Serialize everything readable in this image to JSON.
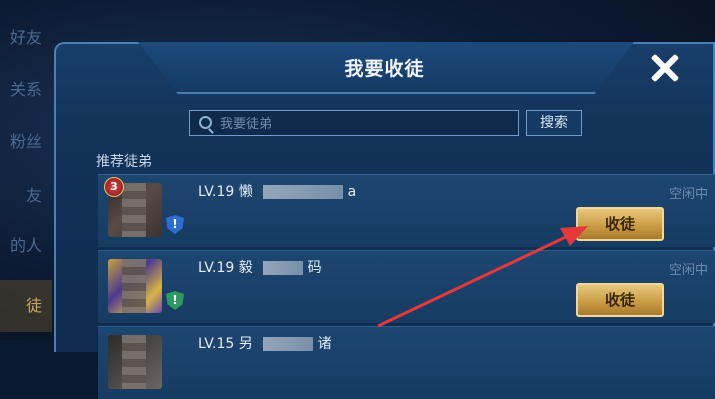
{
  "left_nav": [
    {
      "label": "好友",
      "active": false
    },
    {
      "label": "关系",
      "active": false
    },
    {
      "label": "粉丝",
      "active": false
    },
    {
      "label": "友",
      "active": false
    },
    {
      "label": "的人",
      "active": false
    },
    {
      "label": "徒",
      "active": true
    }
  ],
  "dialog": {
    "title": "我要收徒",
    "close_icon": "close-icon"
  },
  "search": {
    "placeholder": "我要徒弟",
    "button_label": "搜索",
    "icon": "search-icon"
  },
  "section": {
    "label": "推荐徒弟"
  },
  "recommended": [
    {
      "level": "LV.19",
      "name": "懒",
      "name_suffix": "a",
      "status": "空闲中",
      "button": "收徒",
      "rank_badge": "3",
      "shield": "!"
    },
    {
      "level": "LV.19",
      "name": "毅",
      "name_suffix": "码",
      "status": "空闲中",
      "button": "收徒",
      "rank_badge": "",
      "shield": "!"
    },
    {
      "level": "LV.15",
      "name": "另",
      "name_suffix": "诸",
      "status": "",
      "button": "",
      "rank_badge": "",
      "shield": ""
    }
  ],
  "colors": {
    "accent_gold": "#e9c77c",
    "arrow_red": "#e5383b",
    "panel_blue": "#123257"
  }
}
